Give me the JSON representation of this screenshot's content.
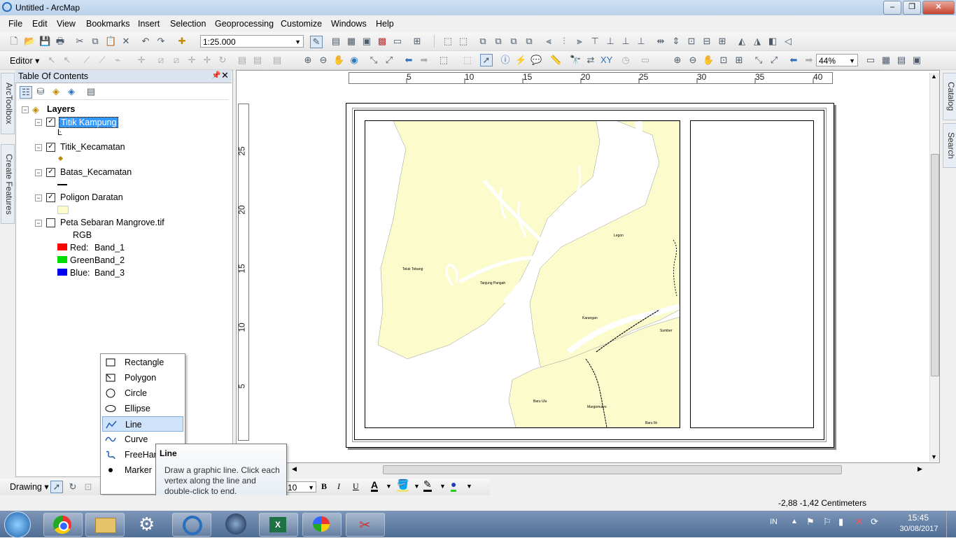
{
  "app": {
    "title": "Untitled - ArcMap"
  },
  "menubar": {
    "items": [
      "File",
      "Edit",
      "View",
      "Bookmarks",
      "Insert",
      "Selection",
      "Geoprocessing",
      "Customize",
      "Windows",
      "Help"
    ]
  },
  "toolbar": {
    "scale": "1:25.000",
    "editor_label": "Editor",
    "zoom_level": "44%"
  },
  "toc": {
    "title": "Table Of Contents",
    "root_label": "Layers",
    "layers": [
      {
        "name": "Titik Kampung",
        "checked": true,
        "selected": true
      },
      {
        "name": "Titik_Kecamatan",
        "checked": true,
        "selected": false
      },
      {
        "name": "Batas_Kecamatan",
        "checked": true,
        "selected": false
      },
      {
        "name": "Poligon Daratan",
        "checked": true,
        "selected": false
      },
      {
        "name": "Peta Sebaran Mangrove.tif",
        "checked": false,
        "selected": false
      }
    ],
    "rgb_label": "RGB",
    "bands": [
      {
        "label": "Red:",
        "band": "Band_1",
        "color": "#ff0000"
      },
      {
        "label": "Green:",
        "band": "Band_2",
        "color": "#00dd00"
      },
      {
        "label": "Blue:",
        "band": "Band_3",
        "color": "#0000ee"
      }
    ]
  },
  "side_tabs": {
    "left": [
      "ArcToolbox",
      "Create Features"
    ],
    "right": [
      "Catalog",
      "Search"
    ]
  },
  "rulers": {
    "h_labels": [
      "5",
      "10",
      "15",
      "20",
      "25",
      "30",
      "35",
      "40"
    ],
    "v_labels": [
      "25",
      "20",
      "15",
      "10",
      "5"
    ]
  },
  "map": {
    "land_color": "#fbfbcc",
    "places": [
      "Teluk Tebang",
      "Tanjung Pangah",
      "Legon",
      "Karangan",
      "Sumber",
      "Baru Ulu",
      "Margomulyo",
      "Baru Ilir"
    ]
  },
  "drawing_toolbar": {
    "label": "Drawing",
    "font_size": "10",
    "bold": "B",
    "italic": "I",
    "underline": "U"
  },
  "drawing_menu": {
    "items": [
      {
        "label": "Rectangle",
        "icon": "rectangle-icon",
        "selected": false
      },
      {
        "label": "Polygon",
        "icon": "polygon-icon",
        "selected": false
      },
      {
        "label": "Circle",
        "icon": "circle-icon",
        "selected": false
      },
      {
        "label": "Ellipse",
        "icon": "ellipse-icon",
        "selected": false
      },
      {
        "label": "Line",
        "icon": "line-icon",
        "selected": true
      },
      {
        "label": "Curve",
        "icon": "curve-icon",
        "selected": false
      },
      {
        "label": "FreeHan",
        "icon": "freehand-icon",
        "selected": false
      },
      {
        "label": "Marker",
        "icon": "marker-icon",
        "selected": false
      }
    ]
  },
  "tooltip": {
    "title": "Line",
    "body": "Draw a graphic line. Click each vertex along the line and double-click to end."
  },
  "status": {
    "coords": "-2,88  -1,42 Centimeters"
  },
  "taskbar": {
    "lang": "IN",
    "time": "15:45",
    "date": "30/08/2017"
  }
}
